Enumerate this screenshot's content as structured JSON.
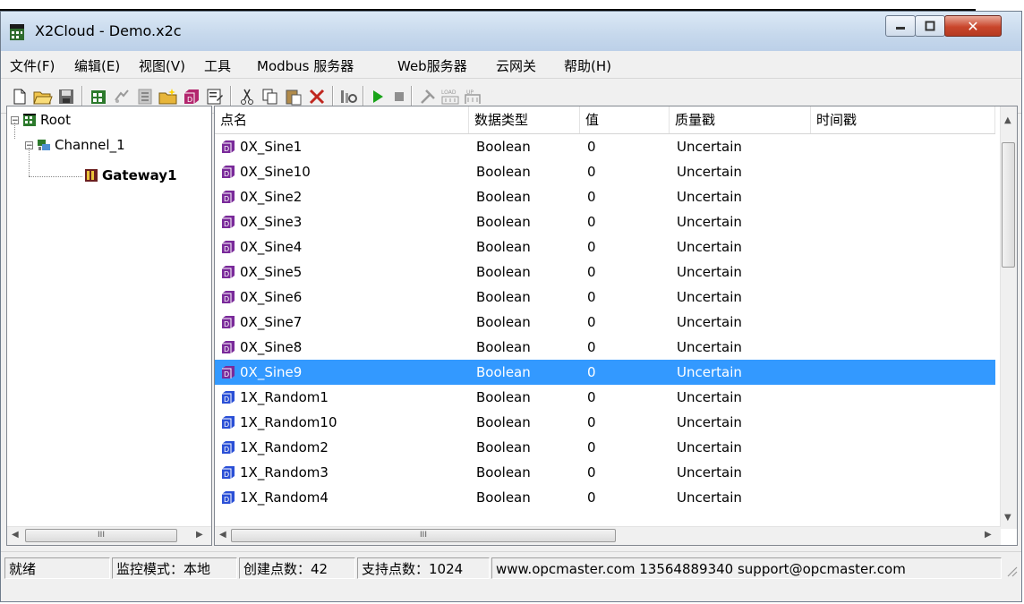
{
  "window": {
    "title": "X2Cloud - Demo.x2c"
  },
  "menu": [
    "文件(F)",
    "编辑(E)",
    "视图(V)",
    "工具",
    "Modbus 服务器",
    "Web服务器",
    "云网关",
    "帮助(H)"
  ],
  "tree": {
    "root": "Root",
    "channel": "Channel_1",
    "device": "Gateway1"
  },
  "table": {
    "columns": [
      "点名",
      "数据类型",
      "值",
      "质量戳",
      "时间戳"
    ],
    "rows": [
      {
        "name": "0X_Sine1",
        "type": "Boolean",
        "value": "0",
        "quality": "Uncertain",
        "time": ""
      },
      {
        "name": "0X_Sine10",
        "type": "Boolean",
        "value": "0",
        "quality": "Uncertain",
        "time": ""
      },
      {
        "name": "0X_Sine2",
        "type": "Boolean",
        "value": "0",
        "quality": "Uncertain",
        "time": ""
      },
      {
        "name": "0X_Sine3",
        "type": "Boolean",
        "value": "0",
        "quality": "Uncertain",
        "time": ""
      },
      {
        "name": "0X_Sine4",
        "type": "Boolean",
        "value": "0",
        "quality": "Uncertain",
        "time": ""
      },
      {
        "name": "0X_Sine5",
        "type": "Boolean",
        "value": "0",
        "quality": "Uncertain",
        "time": ""
      },
      {
        "name": "0X_Sine6",
        "type": "Boolean",
        "value": "0",
        "quality": "Uncertain",
        "time": ""
      },
      {
        "name": "0X_Sine7",
        "type": "Boolean",
        "value": "0",
        "quality": "Uncertain",
        "time": ""
      },
      {
        "name": "0X_Sine8",
        "type": "Boolean",
        "value": "0",
        "quality": "Uncertain",
        "time": ""
      },
      {
        "name": "0X_Sine9",
        "type": "Boolean",
        "value": "0",
        "quality": "Uncertain",
        "time": "",
        "selected": true
      },
      {
        "name": "1X_Random1",
        "type": "Boolean",
        "value": "0",
        "quality": "Uncertain",
        "time": ""
      },
      {
        "name": "1X_Random10",
        "type": "Boolean",
        "value": "0",
        "quality": "Uncertain",
        "time": ""
      },
      {
        "name": "1X_Random2",
        "type": "Boolean",
        "value": "0",
        "quality": "Uncertain",
        "time": ""
      },
      {
        "name": "1X_Random3",
        "type": "Boolean",
        "value": "0",
        "quality": "Uncertain",
        "time": ""
      },
      {
        "name": "1X_Random4",
        "type": "Boolean",
        "value": "0",
        "quality": "Uncertain",
        "time": ""
      }
    ]
  },
  "status": {
    "ready": "就绪",
    "mode": "监控模式：本地",
    "created": "创建点数：42",
    "supported": "支持点数：1024",
    "contact": "www.opcmaster.com 13564889340 support@opcmaster.com"
  },
  "colors": {
    "selection": "#3399ff",
    "purple_icon": "#7a2a9a",
    "blue_icon": "#2a4fd6"
  }
}
